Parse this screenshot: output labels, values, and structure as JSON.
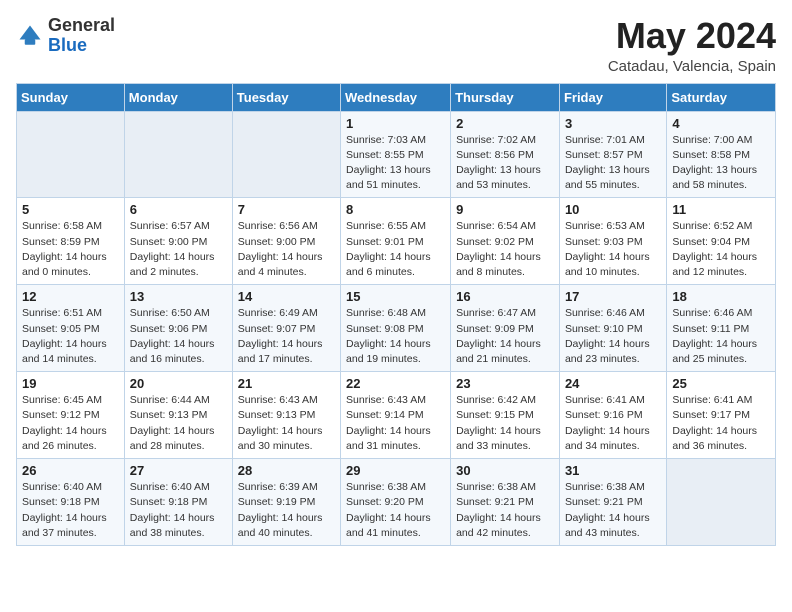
{
  "header": {
    "logo_general": "General",
    "logo_blue": "Blue",
    "month_title": "May 2024",
    "location": "Catadau, Valencia, Spain"
  },
  "weekdays": [
    "Sunday",
    "Monday",
    "Tuesday",
    "Wednesday",
    "Thursday",
    "Friday",
    "Saturday"
  ],
  "weeks": [
    [
      {
        "day": "",
        "sunrise": "",
        "sunset": "",
        "daylight": ""
      },
      {
        "day": "",
        "sunrise": "",
        "sunset": "",
        "daylight": ""
      },
      {
        "day": "",
        "sunrise": "",
        "sunset": "",
        "daylight": ""
      },
      {
        "day": "1",
        "sunrise": "Sunrise: 7:03 AM",
        "sunset": "Sunset: 8:55 PM",
        "daylight": "Daylight: 13 hours and 51 minutes."
      },
      {
        "day": "2",
        "sunrise": "Sunrise: 7:02 AM",
        "sunset": "Sunset: 8:56 PM",
        "daylight": "Daylight: 13 hours and 53 minutes."
      },
      {
        "day": "3",
        "sunrise": "Sunrise: 7:01 AM",
        "sunset": "Sunset: 8:57 PM",
        "daylight": "Daylight: 13 hours and 55 minutes."
      },
      {
        "day": "4",
        "sunrise": "Sunrise: 7:00 AM",
        "sunset": "Sunset: 8:58 PM",
        "daylight": "Daylight: 13 hours and 58 minutes."
      }
    ],
    [
      {
        "day": "5",
        "sunrise": "Sunrise: 6:58 AM",
        "sunset": "Sunset: 8:59 PM",
        "daylight": "Daylight: 14 hours and 0 minutes."
      },
      {
        "day": "6",
        "sunrise": "Sunrise: 6:57 AM",
        "sunset": "Sunset: 9:00 PM",
        "daylight": "Daylight: 14 hours and 2 minutes."
      },
      {
        "day": "7",
        "sunrise": "Sunrise: 6:56 AM",
        "sunset": "Sunset: 9:00 PM",
        "daylight": "Daylight: 14 hours and 4 minutes."
      },
      {
        "day": "8",
        "sunrise": "Sunrise: 6:55 AM",
        "sunset": "Sunset: 9:01 PM",
        "daylight": "Daylight: 14 hours and 6 minutes."
      },
      {
        "day": "9",
        "sunrise": "Sunrise: 6:54 AM",
        "sunset": "Sunset: 9:02 PM",
        "daylight": "Daylight: 14 hours and 8 minutes."
      },
      {
        "day": "10",
        "sunrise": "Sunrise: 6:53 AM",
        "sunset": "Sunset: 9:03 PM",
        "daylight": "Daylight: 14 hours and 10 minutes."
      },
      {
        "day": "11",
        "sunrise": "Sunrise: 6:52 AM",
        "sunset": "Sunset: 9:04 PM",
        "daylight": "Daylight: 14 hours and 12 minutes."
      }
    ],
    [
      {
        "day": "12",
        "sunrise": "Sunrise: 6:51 AM",
        "sunset": "Sunset: 9:05 PM",
        "daylight": "Daylight: 14 hours and 14 minutes."
      },
      {
        "day": "13",
        "sunrise": "Sunrise: 6:50 AM",
        "sunset": "Sunset: 9:06 PM",
        "daylight": "Daylight: 14 hours and 16 minutes."
      },
      {
        "day": "14",
        "sunrise": "Sunrise: 6:49 AM",
        "sunset": "Sunset: 9:07 PM",
        "daylight": "Daylight: 14 hours and 17 minutes."
      },
      {
        "day": "15",
        "sunrise": "Sunrise: 6:48 AM",
        "sunset": "Sunset: 9:08 PM",
        "daylight": "Daylight: 14 hours and 19 minutes."
      },
      {
        "day": "16",
        "sunrise": "Sunrise: 6:47 AM",
        "sunset": "Sunset: 9:09 PM",
        "daylight": "Daylight: 14 hours and 21 minutes."
      },
      {
        "day": "17",
        "sunrise": "Sunrise: 6:46 AM",
        "sunset": "Sunset: 9:10 PM",
        "daylight": "Daylight: 14 hours and 23 minutes."
      },
      {
        "day": "18",
        "sunrise": "Sunrise: 6:46 AM",
        "sunset": "Sunset: 9:11 PM",
        "daylight": "Daylight: 14 hours and 25 minutes."
      }
    ],
    [
      {
        "day": "19",
        "sunrise": "Sunrise: 6:45 AM",
        "sunset": "Sunset: 9:12 PM",
        "daylight": "Daylight: 14 hours and 26 minutes."
      },
      {
        "day": "20",
        "sunrise": "Sunrise: 6:44 AM",
        "sunset": "Sunset: 9:13 PM",
        "daylight": "Daylight: 14 hours and 28 minutes."
      },
      {
        "day": "21",
        "sunrise": "Sunrise: 6:43 AM",
        "sunset": "Sunset: 9:13 PM",
        "daylight": "Daylight: 14 hours and 30 minutes."
      },
      {
        "day": "22",
        "sunrise": "Sunrise: 6:43 AM",
        "sunset": "Sunset: 9:14 PM",
        "daylight": "Daylight: 14 hours and 31 minutes."
      },
      {
        "day": "23",
        "sunrise": "Sunrise: 6:42 AM",
        "sunset": "Sunset: 9:15 PM",
        "daylight": "Daylight: 14 hours and 33 minutes."
      },
      {
        "day": "24",
        "sunrise": "Sunrise: 6:41 AM",
        "sunset": "Sunset: 9:16 PM",
        "daylight": "Daylight: 14 hours and 34 minutes."
      },
      {
        "day": "25",
        "sunrise": "Sunrise: 6:41 AM",
        "sunset": "Sunset: 9:17 PM",
        "daylight": "Daylight: 14 hours and 36 minutes."
      }
    ],
    [
      {
        "day": "26",
        "sunrise": "Sunrise: 6:40 AM",
        "sunset": "Sunset: 9:18 PM",
        "daylight": "Daylight: 14 hours and 37 minutes."
      },
      {
        "day": "27",
        "sunrise": "Sunrise: 6:40 AM",
        "sunset": "Sunset: 9:18 PM",
        "daylight": "Daylight: 14 hours and 38 minutes."
      },
      {
        "day": "28",
        "sunrise": "Sunrise: 6:39 AM",
        "sunset": "Sunset: 9:19 PM",
        "daylight": "Daylight: 14 hours and 40 minutes."
      },
      {
        "day": "29",
        "sunrise": "Sunrise: 6:38 AM",
        "sunset": "Sunset: 9:20 PM",
        "daylight": "Daylight: 14 hours and 41 minutes."
      },
      {
        "day": "30",
        "sunrise": "Sunrise: 6:38 AM",
        "sunset": "Sunset: 9:21 PM",
        "daylight": "Daylight: 14 hours and 42 minutes."
      },
      {
        "day": "31",
        "sunrise": "Sunrise: 6:38 AM",
        "sunset": "Sunset: 9:21 PM",
        "daylight": "Daylight: 14 hours and 43 minutes."
      },
      {
        "day": "",
        "sunrise": "",
        "sunset": "",
        "daylight": ""
      }
    ]
  ]
}
